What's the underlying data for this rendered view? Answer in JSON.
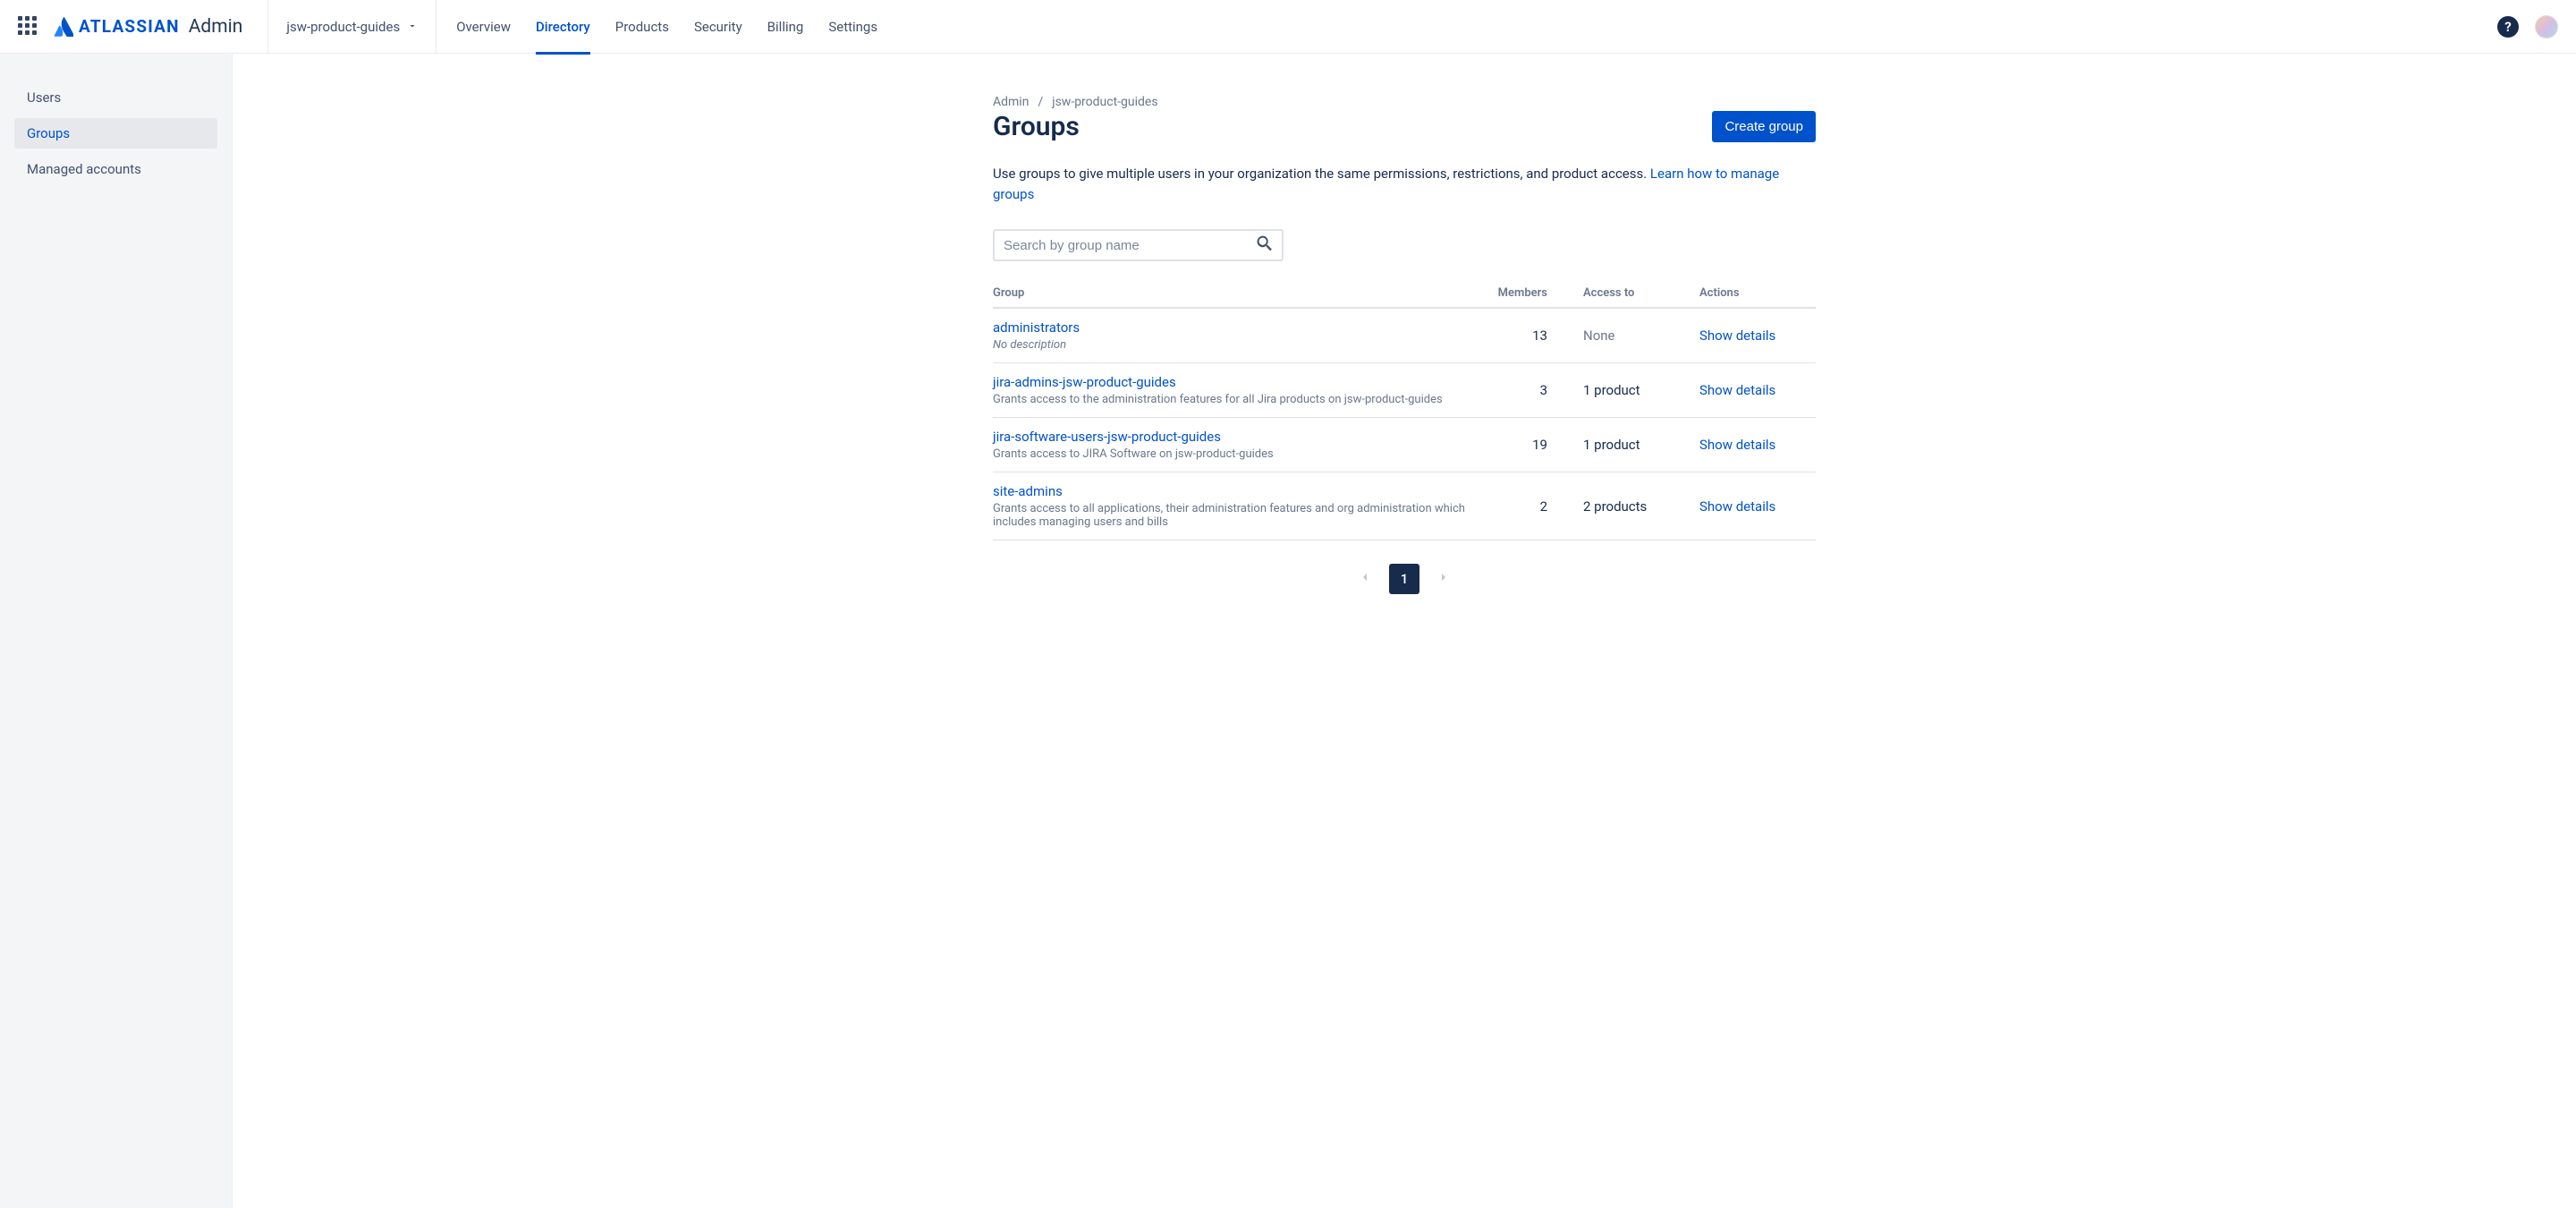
{
  "header": {
    "brand_name": "ATLASSIAN",
    "brand_suffix": "Admin",
    "org_name": "jsw-product-guides",
    "nav": {
      "overview": "Overview",
      "directory": "Directory",
      "products": "Products",
      "security": "Security",
      "billing": "Billing",
      "settings": "Settings"
    }
  },
  "sidebar": {
    "items": [
      {
        "label": "Users"
      },
      {
        "label": "Groups"
      },
      {
        "label": "Managed accounts"
      }
    ]
  },
  "breadcrumbs": {
    "admin": "Admin",
    "org": "jsw-product-guides"
  },
  "page": {
    "title": "Groups",
    "create_button": "Create group",
    "description": "Use groups to give multiple users in your organization the same permissions, restrictions, and product access. ",
    "learn_link": "Learn how to manage groups",
    "search_placeholder": "Search by group name"
  },
  "table": {
    "headers": {
      "group": "Group",
      "members": "Members",
      "access": "Access to",
      "actions": "Actions"
    },
    "rows": [
      {
        "name": "administrators",
        "desc": "No description",
        "desc_italic": true,
        "members": "13",
        "access": "None",
        "access_muted": true,
        "action": "Show details"
      },
      {
        "name": "jira-admins-jsw-product-guides",
        "desc": "Grants access to the administration features for all Jira products on jsw-product-guides",
        "desc_italic": false,
        "members": "3",
        "access": "1 product",
        "access_muted": false,
        "action": "Show details"
      },
      {
        "name": "jira-software-users-jsw-product-guides",
        "desc": "Grants access to JIRA Software on jsw-product-guides",
        "desc_italic": false,
        "members": "19",
        "access": "1 product",
        "access_muted": false,
        "action": "Show details"
      },
      {
        "name": "site-admins",
        "desc": "Grants access to all applications, their administration features and org administration which includes managing users and bills",
        "desc_italic": false,
        "members": "2",
        "access": "2 products",
        "access_muted": false,
        "action": "Show details"
      }
    ]
  },
  "pagination": {
    "current": "1"
  }
}
